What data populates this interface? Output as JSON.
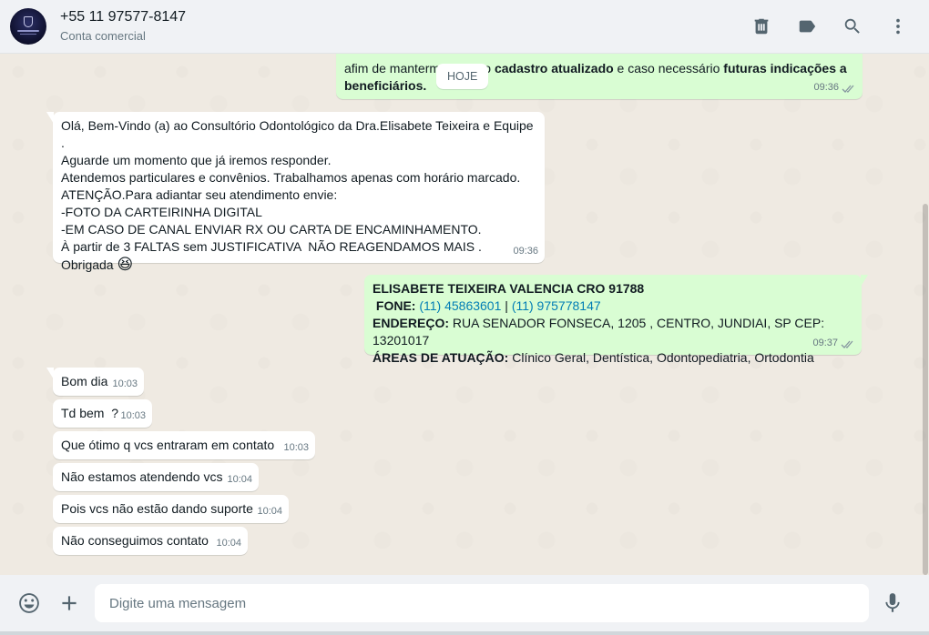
{
  "header": {
    "contact_name": "+55 11 97577-8147",
    "contact_subtitle": "Conta comercial",
    "icons": [
      "delete-icon",
      "label-icon",
      "search-icon",
      "menu-icon"
    ]
  },
  "chat": {
    "date_chip": "HOJE",
    "msg_top": {
      "line1_prefix": "afim de mantermos ",
      "line1_mid": "nosso ",
      "line1_bold1": "cadastro atualizado",
      "line1_mid2": " e caso necessário ",
      "line1_bold2": "futuras indicações a",
      "line2_bold": "beneficiários.",
      "time": "09:36"
    },
    "msg_welcome": {
      "lines": [
        "Olá, Bem-Vindo (a) ao Consultório Odontológico da Dra.Elisabete Teixeira e Equipe .",
        "Aguarde um momento que já iremos responder.",
        "Atendemos particulares e convênios. Trabalhamos apenas com horário marcado.",
        "ATENÇÃO.Para adiantar seu atendimento envie:",
        "-FOTO DA CARTEIRINHA DIGITAL",
        "-EM CASO DE CANAL ENVIAR RX OU CARTA DE ENCAMINHAMENTO.",
        "À partir de 3 FALTAS sem JUSTIFICATIVA  NÃO REAGENDAMOS MAIS .",
        "Obrigada"
      ],
      "emoji": "😆",
      "time": "09:36"
    },
    "msg_card": {
      "title": "ELISABETE TEIXEIRA VALENCIA CRO 91788",
      "phone_label": "FONE:",
      "phone1": "(11) 45863601",
      "phone_sep": "|",
      "phone2": "(11) 975778147",
      "address_label": "ENDEREÇO:",
      "address": "RUA SENADOR FONSECA, 1205 , CENTRO, JUNDIAI, SP CEP: 13201017",
      "areas_label": "ÁREAS DE ATUAÇÃO:",
      "areas": "Clínico Geral, Dentística, Odontopediatria, Ortodontia",
      "time": "09:37"
    },
    "incoming": [
      {
        "text": "Bom dia",
        "time": "10:03"
      },
      {
        "text": "Td bem  ?",
        "time": "10:03"
      },
      {
        "text": "Que ótimo q vcs entraram em contato",
        "time": "10:03"
      },
      {
        "text": "Não estamos atendendo vcs",
        "time": "10:04"
      },
      {
        "text": "Pois vcs não estão dando suporte",
        "time": "10:04"
      },
      {
        "text": "Não conseguimos contato",
        "time": "10:04"
      }
    ]
  },
  "footer": {
    "placeholder": "Digite uma mensagem"
  },
  "colors": {
    "outgoing_bubble": "#d9fdd3",
    "incoming_bubble": "#ffffff",
    "chat_background": "#efeae2",
    "link": "#027eb5"
  }
}
